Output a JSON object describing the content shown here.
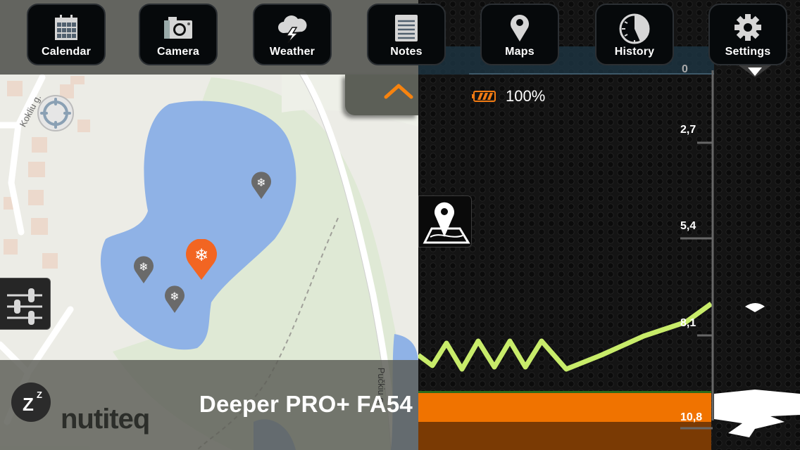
{
  "menu": {
    "items": [
      {
        "id": "calendar",
        "label": "Calendar",
        "icon": "calendar-icon"
      },
      {
        "id": "camera",
        "label": "Camera",
        "icon": "camera-icon"
      },
      {
        "id": "weather",
        "label": "Weather",
        "icon": "weather-icon"
      },
      {
        "id": "notes",
        "label": "Notes",
        "icon": "notes-icon"
      },
      {
        "id": "maps",
        "label": "Maps",
        "icon": "maps-icon"
      },
      {
        "id": "history",
        "label": "History",
        "icon": "history-icon"
      },
      {
        "id": "settings",
        "label": "Settings",
        "icon": "gear-icon"
      }
    ]
  },
  "map": {
    "streets": [
      "Kokliu g.",
      "Pučkiu g."
    ],
    "attribution": "nutiteq",
    "markers": [
      {
        "type": "fishing-spot",
        "selected": false,
        "icon": "snowflake-icon"
      },
      {
        "type": "fishing-spot",
        "selected": true,
        "icon": "snowflake-icon"
      },
      {
        "type": "fishing-spot",
        "selected": false,
        "icon": "snowflake-icon"
      },
      {
        "type": "fishing-spot",
        "selected": false,
        "icon": "snowflake-icon"
      }
    ],
    "colors": {
      "water": "#8fb2e6",
      "land": "#dfe9d5",
      "marker": "#6a6a6a",
      "marker_selected": "#f26522"
    }
  },
  "device": {
    "name": "Deeper PRO+ FA54"
  },
  "battery": {
    "level": "100%",
    "color": "#f07a12"
  },
  "sonar": {
    "depth_scale": [
      "0",
      "2,7",
      "5,4",
      "8,1",
      "10,8"
    ],
    "bottom_color": "#f07300",
    "fish_line_color": "#c8ec6a"
  }
}
